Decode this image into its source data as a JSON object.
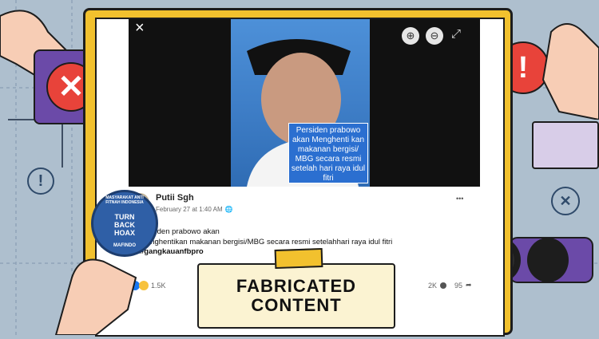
{
  "viewer": {
    "close_icon": "×",
    "zoom_in_icon": "⊕",
    "zoom_out_icon": "⊖",
    "expand_icon": "⤢",
    "caption": "Persiden prabowo akan Menghenti kan makanan bergisi/ MBG secara resmi setelah hari raya idul fitri"
  },
  "post": {
    "author": "Putii Sgh",
    "date": "February 27 at 1:40 AM",
    "globe_icon": "🌐",
    "more_icon": "•••",
    "line1": "Persiden prabowo akan",
    "line2": "menghentikan makanan bergisi/MBG secara resmi setelahhari raya idul fitri",
    "hashtag": "#gangkauanfbpro",
    "reactions_count": "1.5K",
    "comments_count": "2K",
    "shares_count": "95"
  },
  "badge": {
    "center": "TURN BACK HOAX",
    "ring": "MASYARAKAT ANTI FITNAH INDONESIA",
    "bottom": "MAFINDO"
  },
  "banner": {
    "line1": "FABRICATED",
    "line2": "CONTENT"
  },
  "colors": {
    "background": "#aebfce",
    "monitor": "#f2c12e",
    "alert_red": "#e8433a",
    "purple": "#6b4aa8",
    "caption_blue": "#2b6fd0"
  }
}
